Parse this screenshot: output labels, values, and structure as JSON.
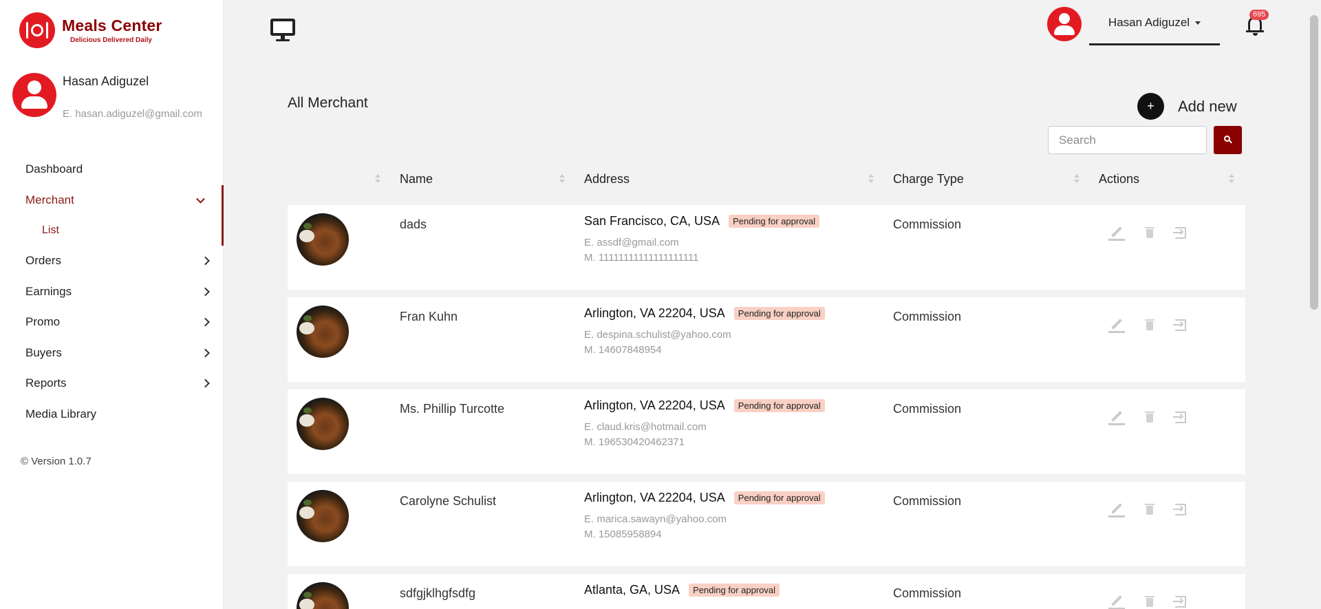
{
  "brand": {
    "title": "Meals Center",
    "tagline": "Delicious Delivered Daily",
    "color": "#8b0000"
  },
  "profile": {
    "name": "Hasan Adiguzel",
    "email": "E. hasan.adiguzel@gmail.com"
  },
  "sidebar": {
    "items": [
      {
        "label": "Dashboard"
      },
      {
        "label": "Merchant"
      },
      {
        "label": "List"
      },
      {
        "label": "Orders"
      },
      {
        "label": "Earnings"
      },
      {
        "label": "Promo"
      },
      {
        "label": "Buyers"
      },
      {
        "label": "Reports"
      },
      {
        "label": "Media Library"
      }
    ],
    "version": "© Version 1.0.7"
  },
  "topbar": {
    "user_name": "Hasan Adiguzel",
    "notification_count": "695"
  },
  "main": {
    "title": "All Merchant",
    "add_new_label": "Add new",
    "add_new_symbol": "+",
    "search_placeholder": "Search",
    "columns": [
      "Name",
      "Address",
      "Charge Type",
      "Actions"
    ],
    "rows": [
      {
        "name": "dads",
        "address": "San Francisco, CA, USA",
        "status": "Pending for approval",
        "email": "E. assdf@gmail.com",
        "mobile": "M. 11111111111111111111",
        "charge_type": "Commission"
      },
      {
        "name": "Fran Kuhn",
        "address": "Arlington, VA 22204, USA",
        "status": "Pending for approval",
        "email": "E. despina.schulist@yahoo.com",
        "mobile": "M. 14607848954",
        "charge_type": "Commission"
      },
      {
        "name": "Ms. Phillip Turcotte",
        "address": "Arlington, VA 22204, USA",
        "status": "Pending for approval",
        "email": "E. claud.kris@hotmail.com",
        "mobile": "M. 196530420462371",
        "charge_type": "Commission"
      },
      {
        "name": "Carolyne Schulist",
        "address": "Arlington, VA 22204, USA",
        "status": "Pending for approval",
        "email": "E. marica.sawayn@yahoo.com",
        "mobile": "M. 15085958894",
        "charge_type": "Commission"
      },
      {
        "name": "sdfgjklhgfsdfg",
        "address": "Atlanta, GA, USA",
        "status": "Pending for approval",
        "email": "",
        "mobile": "",
        "charge_type": "Commission"
      }
    ]
  }
}
